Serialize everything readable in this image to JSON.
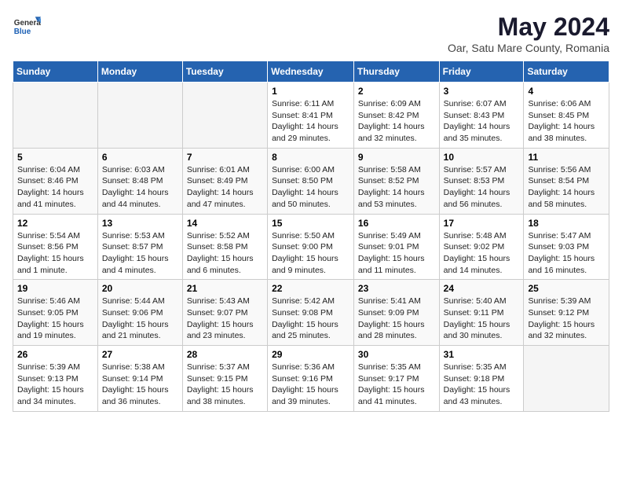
{
  "header": {
    "logo_general": "General",
    "logo_blue": "Blue",
    "month_year": "May 2024",
    "location": "Oar, Satu Mare County, Romania"
  },
  "days_of_week": [
    "Sunday",
    "Monday",
    "Tuesday",
    "Wednesday",
    "Thursday",
    "Friday",
    "Saturday"
  ],
  "weeks": [
    [
      {
        "day": "",
        "info": ""
      },
      {
        "day": "",
        "info": ""
      },
      {
        "day": "",
        "info": ""
      },
      {
        "day": "1",
        "info": "Sunrise: 6:11 AM\nSunset: 8:41 PM\nDaylight: 14 hours\nand 29 minutes."
      },
      {
        "day": "2",
        "info": "Sunrise: 6:09 AM\nSunset: 8:42 PM\nDaylight: 14 hours\nand 32 minutes."
      },
      {
        "day": "3",
        "info": "Sunrise: 6:07 AM\nSunset: 8:43 PM\nDaylight: 14 hours\nand 35 minutes."
      },
      {
        "day": "4",
        "info": "Sunrise: 6:06 AM\nSunset: 8:45 PM\nDaylight: 14 hours\nand 38 minutes."
      }
    ],
    [
      {
        "day": "5",
        "info": "Sunrise: 6:04 AM\nSunset: 8:46 PM\nDaylight: 14 hours\nand 41 minutes."
      },
      {
        "day": "6",
        "info": "Sunrise: 6:03 AM\nSunset: 8:48 PM\nDaylight: 14 hours\nand 44 minutes."
      },
      {
        "day": "7",
        "info": "Sunrise: 6:01 AM\nSunset: 8:49 PM\nDaylight: 14 hours\nand 47 minutes."
      },
      {
        "day": "8",
        "info": "Sunrise: 6:00 AM\nSunset: 8:50 PM\nDaylight: 14 hours\nand 50 minutes."
      },
      {
        "day": "9",
        "info": "Sunrise: 5:58 AM\nSunset: 8:52 PM\nDaylight: 14 hours\nand 53 minutes."
      },
      {
        "day": "10",
        "info": "Sunrise: 5:57 AM\nSunset: 8:53 PM\nDaylight: 14 hours\nand 56 minutes."
      },
      {
        "day": "11",
        "info": "Sunrise: 5:56 AM\nSunset: 8:54 PM\nDaylight: 14 hours\nand 58 minutes."
      }
    ],
    [
      {
        "day": "12",
        "info": "Sunrise: 5:54 AM\nSunset: 8:56 PM\nDaylight: 15 hours\nand 1 minute."
      },
      {
        "day": "13",
        "info": "Sunrise: 5:53 AM\nSunset: 8:57 PM\nDaylight: 15 hours\nand 4 minutes."
      },
      {
        "day": "14",
        "info": "Sunrise: 5:52 AM\nSunset: 8:58 PM\nDaylight: 15 hours\nand 6 minutes."
      },
      {
        "day": "15",
        "info": "Sunrise: 5:50 AM\nSunset: 9:00 PM\nDaylight: 15 hours\nand 9 minutes."
      },
      {
        "day": "16",
        "info": "Sunrise: 5:49 AM\nSunset: 9:01 PM\nDaylight: 15 hours\nand 11 minutes."
      },
      {
        "day": "17",
        "info": "Sunrise: 5:48 AM\nSunset: 9:02 PM\nDaylight: 15 hours\nand 14 minutes."
      },
      {
        "day": "18",
        "info": "Sunrise: 5:47 AM\nSunset: 9:03 PM\nDaylight: 15 hours\nand 16 minutes."
      }
    ],
    [
      {
        "day": "19",
        "info": "Sunrise: 5:46 AM\nSunset: 9:05 PM\nDaylight: 15 hours\nand 19 minutes."
      },
      {
        "day": "20",
        "info": "Sunrise: 5:44 AM\nSunset: 9:06 PM\nDaylight: 15 hours\nand 21 minutes."
      },
      {
        "day": "21",
        "info": "Sunrise: 5:43 AM\nSunset: 9:07 PM\nDaylight: 15 hours\nand 23 minutes."
      },
      {
        "day": "22",
        "info": "Sunrise: 5:42 AM\nSunset: 9:08 PM\nDaylight: 15 hours\nand 25 minutes."
      },
      {
        "day": "23",
        "info": "Sunrise: 5:41 AM\nSunset: 9:09 PM\nDaylight: 15 hours\nand 28 minutes."
      },
      {
        "day": "24",
        "info": "Sunrise: 5:40 AM\nSunset: 9:11 PM\nDaylight: 15 hours\nand 30 minutes."
      },
      {
        "day": "25",
        "info": "Sunrise: 5:39 AM\nSunset: 9:12 PM\nDaylight: 15 hours\nand 32 minutes."
      }
    ],
    [
      {
        "day": "26",
        "info": "Sunrise: 5:39 AM\nSunset: 9:13 PM\nDaylight: 15 hours\nand 34 minutes."
      },
      {
        "day": "27",
        "info": "Sunrise: 5:38 AM\nSunset: 9:14 PM\nDaylight: 15 hours\nand 36 minutes."
      },
      {
        "day": "28",
        "info": "Sunrise: 5:37 AM\nSunset: 9:15 PM\nDaylight: 15 hours\nand 38 minutes."
      },
      {
        "day": "29",
        "info": "Sunrise: 5:36 AM\nSunset: 9:16 PM\nDaylight: 15 hours\nand 39 minutes."
      },
      {
        "day": "30",
        "info": "Sunrise: 5:35 AM\nSunset: 9:17 PM\nDaylight: 15 hours\nand 41 minutes."
      },
      {
        "day": "31",
        "info": "Sunrise: 5:35 AM\nSunset: 9:18 PM\nDaylight: 15 hours\nand 43 minutes."
      },
      {
        "day": "",
        "info": ""
      }
    ]
  ]
}
